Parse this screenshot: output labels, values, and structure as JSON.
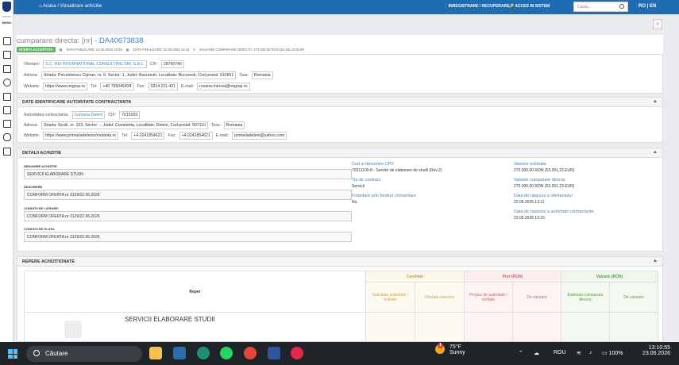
{
  "sidebar": {
    "brand": "PORTAL",
    "menu": "MENU"
  },
  "topbar": {
    "breadcrumb_home": "Acasa",
    "breadcrumb_sep": "/",
    "breadcrumb_current": "Vizualizare achizitie",
    "register": "INREGISTRARE / RECUPERARE",
    "login": "ACCES IN SISTEM",
    "search_placeholder": "Cauta...",
    "lang": "RO | EN"
  },
  "header": {
    "title_prefix": "cumparare directa: [nr] - ",
    "code": "DA40673838",
    "status": "OFERTA ACCEPTATA",
    "date_published": "DATA PUBLICARE: 22.06.2026 10:08",
    "date_final": "DATA FINALIZARE: 22.06.2026 13:16",
    "value": "VALOARE CUMPARARE DIRECTA: 270.000,00 RON (53.291,23 EUR)"
  },
  "offerer": {
    "label": "Ofertant:",
    "name": "S.C. REI INTERNATIONAL CONSULTING SRL S.R.L.",
    "cif_label": "CIF:",
    "cif": "28760740",
    "address_label": "Adresa:",
    "address": "Strada: Porumbescu Ciprian, nr. 6, Sector: 1, Judet: Bucuresti, Localitate: Bucuresti, Cod postal: 010651",
    "country_label": "Tara:",
    "country": "Romania",
    "website_label": "Website:",
    "website": "https://www.reigrup.ro",
    "tel_label": "Tel:",
    "tel": "+40 755046434",
    "fax_label": "Fax:",
    "fax": "0314.211.421",
    "email_label": "E-mail:",
    "email": "roxana.mircea@reigrup.ro"
  },
  "authority": {
    "heading": "DATE IDENTIFICARE AUTORITATE CONTRACTANTA",
    "label": "Autoritatea contractanta:",
    "name": "Comuna Deleni",
    "cif_label": "CIF:",
    "cif": "7015203",
    "address_label": "Adresa:",
    "address": "Strada: Scolii, nr. 103, Sector: -, Judet: Constanta, Localitate: Deleni, Cod postal: 907110",
    "country_label": "Tara:",
    "country": "Romania",
    "website_label": "Website:",
    "website": "https://www.primariadelenicónstanta.ro",
    "tel_label": "Tel:",
    "tel": "+4 0241854621",
    "fax_label": "Fax:",
    "fax": "+4 0241854621",
    "email_label": "E-mail:",
    "email": "primariadeleni@yahoo.com"
  },
  "details": {
    "heading": "DETALII ACHIZITIE",
    "name_label": "DENUMIRE ACHIZITIE",
    "name": "SERVICII ELABORARE STUDII",
    "desc_label": "DESCRIERE",
    "desc": "CONFORM OFERTA nr 3129/22.06.2026",
    "delivery_label": "CONDITII DE LIVRARE:",
    "delivery": "CONFORM OFERTA nr 3129/22.06.2026",
    "payment_label": "CONDITII DE PLATA:",
    "payment": "CONFORM OFERTA nr 3129/22.06.2026",
    "cpv_label": "Cod si denumire CPV",
    "cpv": "79311100-8 - Servicii de elaborare de studii (Rev.2)",
    "contract_label": "Tip de contract",
    "contract": "Servicii",
    "funds_label": "Finantare prin fonduri comunitare",
    "funds": "Nu",
    "est_label": "Valoare estimata",
    "est": "270.000,00 RON (53.291,23 EUR)",
    "buy_label": "Valoare cumparare directa",
    "buy": "270.000,00 RON (53.291,23 EUR)",
    "resp_offer_label": "Data de raspuns a ofertantului",
    "resp_offer": "22.06.2026 13:11",
    "resp_auth_label": "Data de raspuns a autoritatii contractante",
    "resp_auth": "22.06.2026 13:16"
  },
  "repere": {
    "heading": "REPERE ACHIZITIONATE",
    "col_reper": "Reper",
    "col_qty": "Cantitate",
    "col_price": "Pret (RON)",
    "col_value": "Valoare (RON)",
    "sub_qty_req": "Solicitata autoritate / entitate",
    "sub_qty_off": "Ofertata operator",
    "sub_price_prop": "Propus de autoritate / entitate",
    "sub_price_sell": "De vanzare",
    "sub_val_est": "Estimata cumparare directa",
    "sub_val_sell": "De vanzare",
    "item": "SERVICII ELABORARE STUDII"
  },
  "taskbar": {
    "search": "Căutare",
    "weather_temp": "75°F",
    "weather_desc": "Sunny",
    "weather_badge": "1",
    "lang": "ROU",
    "battery": "100%",
    "time": "13:10:55",
    "date": "23.06.2026"
  }
}
